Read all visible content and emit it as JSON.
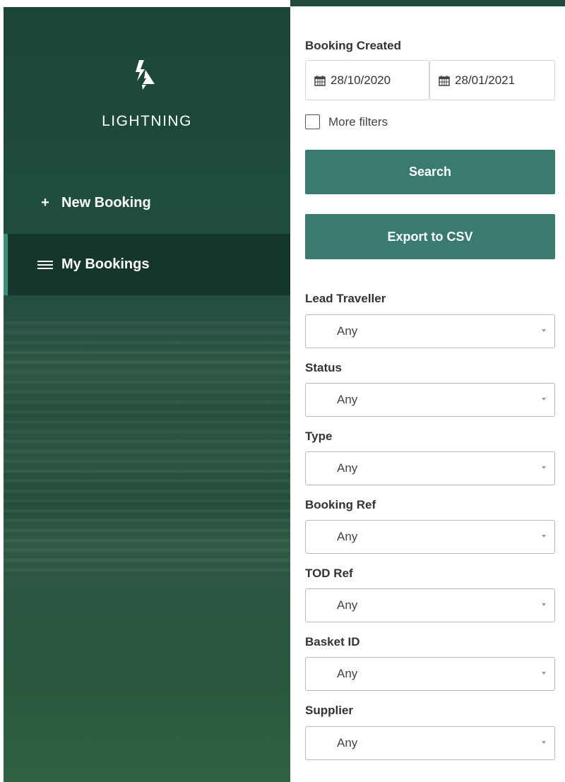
{
  "sidebar": {
    "brand": "LIGHTNING",
    "nav": [
      {
        "icon": "plus-icon",
        "glyph": "+",
        "label": "New Booking"
      },
      {
        "icon": "list-icon",
        "label": "My Bookings",
        "active": true
      }
    ]
  },
  "filters": {
    "booking_created": {
      "label": "Booking Created",
      "from": "28/10/2020",
      "to": "28/01/2021"
    },
    "more_filters_label": "More filters",
    "more_filters_checked": false,
    "search_label": "Search",
    "export_label": "Export to CSV",
    "fields": [
      {
        "label": "Lead Traveller",
        "value": "Any"
      },
      {
        "label": "Status",
        "value": "Any"
      },
      {
        "label": "Type",
        "value": "Any"
      },
      {
        "label": "Booking Ref",
        "value": "Any"
      },
      {
        "label": "TOD Ref",
        "value": "Any"
      },
      {
        "label": "Basket ID",
        "value": "Any"
      },
      {
        "label": "Supplier",
        "value": "Any"
      }
    ]
  },
  "colors": {
    "accent_button": "#3a7b70",
    "sidebar_dark": "#1e4a3b",
    "active_indicator": "#3d8c78"
  }
}
